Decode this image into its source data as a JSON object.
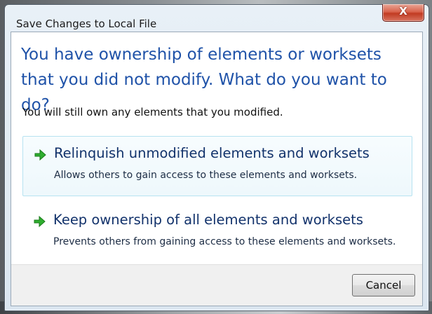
{
  "dialog": {
    "title": "Save Changes to Local File",
    "close_glyph": "X",
    "main_instruction": "You have ownership of elements or worksets that you did not modify. What do you want to do?",
    "content": "You will still own any elements that you modified.",
    "options": [
      {
        "title": "Relinquish unmodified elements and worksets",
        "description": "Allows others to gain access to these elements and worksets.",
        "icon": "green-arrow-icon"
      },
      {
        "title": "Keep ownership of all elements and worksets",
        "description": "Prevents others from gaining access to these elements and worksets.",
        "icon": "green-arrow-icon"
      }
    ],
    "cancel_label": "Cancel"
  },
  "colors": {
    "instruction": "#1f52a8",
    "command_title": "#12326b",
    "arrow": "#2fae2f",
    "close_button": "#c13b22"
  }
}
